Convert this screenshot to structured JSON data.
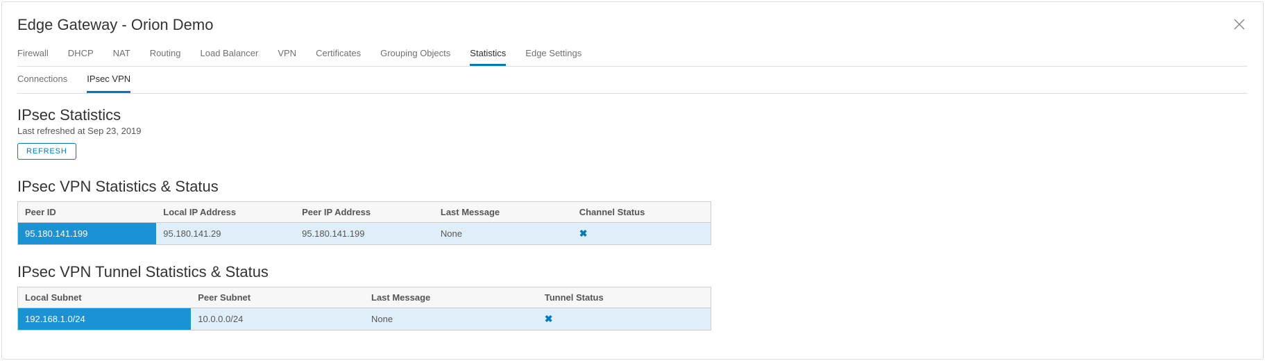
{
  "header": {
    "title": "Edge Gateway - Orion Demo"
  },
  "tabs": {
    "items": [
      "Firewall",
      "DHCP",
      "NAT",
      "Routing",
      "Load Balancer",
      "VPN",
      "Certificates",
      "Grouping Objects",
      "Statistics",
      "Edge Settings"
    ],
    "activeIndex": 8
  },
  "subtabs": {
    "items": [
      "Connections",
      "IPsec VPN"
    ],
    "activeIndex": 1
  },
  "stats": {
    "heading": "IPsec Statistics",
    "refreshed": "Last refreshed at Sep 23, 2019",
    "refresh_label": "REFRESH"
  },
  "vpn_table": {
    "title": "IPsec VPN Statistics & Status",
    "headers": [
      "Peer ID",
      "Local IP Address",
      "Peer IP Address",
      "Last Message",
      "Channel Status"
    ],
    "row": {
      "peer_id": "95.180.141.199",
      "local_ip": "95.180.141.29",
      "peer_ip": "95.180.141.199",
      "last_msg": "None",
      "status_icon": "✖"
    }
  },
  "tunnel_table": {
    "title": "IPsec VPN Tunnel Statistics & Status",
    "headers": [
      "Local Subnet",
      "Peer Subnet",
      "Last Message",
      "Tunnel Status"
    ],
    "row": {
      "local_subnet": "192.168.1.0/24",
      "peer_subnet": "10.0.0.0/24",
      "last_msg": "None",
      "status_icon": "✖"
    }
  }
}
